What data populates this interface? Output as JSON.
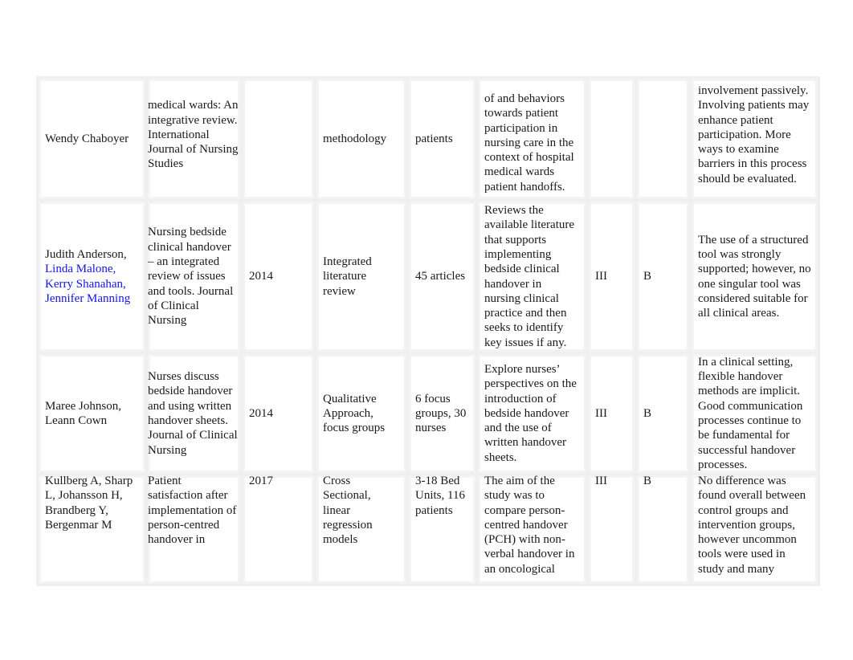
{
  "table": {
    "rows": [
      {
        "authors": "Wendy Chaboyer",
        "author_links": [],
        "title": "medical wards: An integrative review. International Journal of Nursing Studies",
        "year": "",
        "design": "methodology",
        "sample": "patients",
        "purpose": "of and behaviors towards patient participation in nursing care in the context of hospital medical wards patient handoffs.",
        "level": "",
        "quality": "",
        "findings": "involvement passively. Involving patients may enhance patient participation. More ways to examine barriers in this process should be evaluated."
      },
      {
        "authors": "Judith Anderson,",
        "author_links": [
          "Linda Malone,",
          "Kerry Shanahan,",
          "Jennifer Manning"
        ],
        "title": "Nursing bedside clinical handover – an integrated review of issues and tools. Journal of Clinical Nursing",
        "year": "2014",
        "design": "Integrated literature review",
        "sample": "45 articles",
        "purpose": "Reviews the available literature that supports implementing bedside clinical handover in nursing clinical practice and then seeks to identify key issues if any.",
        "level": "III",
        "quality": "B",
        "findings": "The use of a structured tool was strongly supported; however, no one singular tool was considered suitable for all clinical areas."
      },
      {
        "authors": "Maree Johnson, Leann Cown",
        "author_links": [],
        "title": "Nurses discuss bedside handover and using written handover sheets. Journal of Clinical Nursing",
        "year": "2014",
        "design": "Qualitative Approach, focus groups",
        "sample": "6 focus groups, 30 nurses",
        "purpose": "Explore nurses’ perspectives on the introduction of bedside handover and the use of written handover sheets.",
        "level": "III",
        "quality": "B",
        "findings": "In a clinical setting, flexible handover methods are implicit. Good communication processes continue to be fundamental for successful handover processes."
      },
      {
        "authors": "Kullberg A, Sharp L, Johansson H, Brandberg Y, Bergenmar M",
        "author_links": [],
        "title": "Patient satisfaction after implementation of person-centred handover in",
        "year": "2017",
        "design": "Cross Sectional, linear regression models",
        "sample": "3-18 Bed Units, 116 patients",
        "purpose": "The aim of the study was to compare person-centred handover (PCH) with non-verbal handover in an oncological",
        "level": "III",
        "quality": "B",
        "findings": "No difference was found overall between control groups and intervention groups, however uncommon tools were used in study and many"
      }
    ]
  },
  "colors": {
    "link": "#1414e6",
    "text": "#1a1a1a",
    "grid": "#efefef"
  }
}
